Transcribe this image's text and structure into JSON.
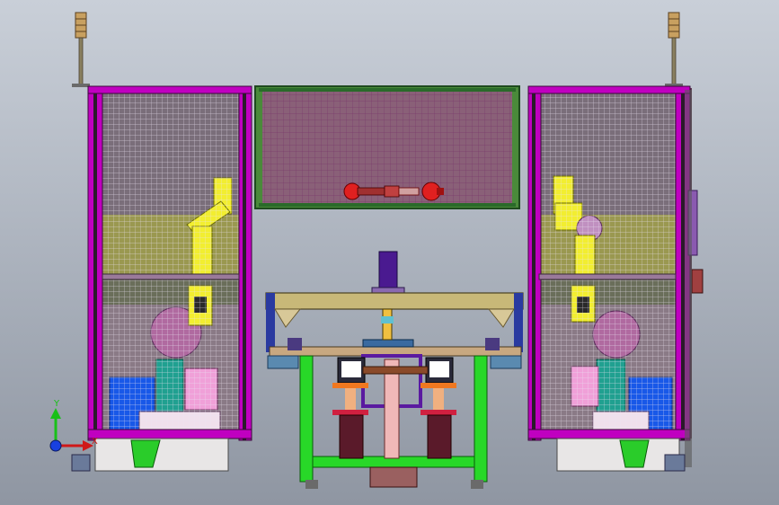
{
  "viewport": {
    "background_top": "#c9cfd8",
    "background_bottom": "#8f96a2"
  },
  "triad": {
    "y_label": "Y",
    "x_label": "X",
    "y_color": "#18c018",
    "x_color": "#d01818",
    "z_color": "#1840e0"
  },
  "colors": {
    "frame_magenta": "#c000c0",
    "frame_dark": "#3a2a44",
    "panel_olive": "#9a9850",
    "mesh_line": "#e8e0ee",
    "robot_yellow": "#f2ee30",
    "table_green": "#28d828",
    "top_panel_green": "#4a8a3a",
    "blue_bin": "#1858e8",
    "teal_part": "#20a090",
    "pink_part": "#f0a0d8",
    "tan_beam": "#c8b878",
    "red_gripper": "#e02020",
    "orange_plate": "#f07820",
    "purple_cylinder": "#4a1a90",
    "tower_light_tan": "#c8a060"
  },
  "icons": {
    "stack_light_left": "stack-light-icon",
    "stack_light_right": "stack-light-icon",
    "robot_left": "robot-arm-icon",
    "robot_right": "robot-arm-icon",
    "gripper_top": "gripper-icon",
    "axis_triad": "coordinate-triad-icon"
  }
}
